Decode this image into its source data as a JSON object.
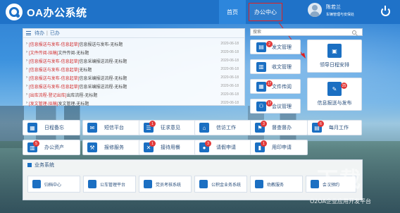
{
  "header": {
    "app_title": "OA办公系统",
    "nav": {
      "home": "首页",
      "office": "办公中心"
    },
    "user": {
      "name": "陈若兰",
      "dept": "车辆管理与安保处"
    }
  },
  "todo": {
    "tabs": [
      "待办",
      "已办"
    ],
    "separator": "|",
    "items": [
      {
        "tag": "[信息报送与发布-信息起草]",
        "text": " 信息报送与发布-无标题",
        "date": "2020-06-18"
      },
      {
        "tag": "[文件传阅-拟稿]",
        "text": " 文件传阅-无标题",
        "date": "2020-06-18"
      },
      {
        "tag": "[信息报送与发布-信息起草]",
        "text": " 信息采编报送流程-无标题",
        "date": "2020-06-18"
      },
      {
        "tag": "[信息报送与发布-信息起草]",
        "text": " 无标题",
        "date": "2020-06-18"
      },
      {
        "tag": "[信息报送与发布-信息起草]",
        "text": " 信息采编报送流程-无标题",
        "date": "2020-06-18"
      },
      {
        "tag": "[信息报送与发布-信息起草]",
        "text": " 信息采编报送流程-无标题",
        "date": "2020-06-18"
      },
      {
        "tag": "[出库流程-登记出库]",
        "text": " 出库流程-无标题",
        "date": "2020-06-18"
      },
      {
        "tag": "[发文管理-拟稿]",
        "text": " 发文管理-无标题",
        "date": "2020-06-18"
      }
    ]
  },
  "search": {
    "placeholder": "搜索"
  },
  "mid_tiles": [
    {
      "label": "发文管理",
      "badge": "2",
      "icon": "document-send-icon"
    },
    {
      "label": "收文管理",
      "badge": "",
      "icon": "document-receive-icon"
    },
    {
      "label": "文件传阅",
      "badge": "17",
      "icon": "file-circulate-icon"
    },
    {
      "label": "会议管理",
      "badge": "17",
      "icon": "meeting-icon"
    }
  ],
  "big_tiles": [
    {
      "label": "领导日程安排",
      "badge": "",
      "icon": "calendar-icon"
    },
    {
      "label": "信息报送与发布",
      "badge": "25",
      "icon": "edit-icon"
    }
  ],
  "row1": [
    {
      "label": "日程备忘",
      "badge": "",
      "icon": "calendar-icon"
    },
    {
      "label": "短信平台",
      "badge": "",
      "icon": "message-icon"
    },
    {
      "label": "征求意见",
      "badge": "1",
      "icon": "opinion-icon"
    },
    {
      "label": "信访工作",
      "badge": "",
      "icon": "house-icon"
    },
    {
      "label": "督查督办",
      "badge": "3",
      "icon": "supervise-icon"
    },
    {
      "label": "每月工作",
      "badge": "6",
      "icon": "monthly-icon"
    }
  ],
  "row2": [
    {
      "label": "办公资产",
      "badge": "5",
      "icon": "assets-icon"
    },
    {
      "label": "报修服务",
      "badge": "",
      "icon": "wrench-icon"
    },
    {
      "label": "接待用餐",
      "badge": "1",
      "icon": "dining-icon"
    },
    {
      "label": "请假申请",
      "badge": "3",
      "icon": "leave-icon"
    },
    {
      "label": "用印申请",
      "badge": "1",
      "icon": "seal-icon"
    }
  ],
  "biz": {
    "title": "业务系统",
    "items": [
      {
        "label": "归档中心",
        "icon": "archive-icon"
      },
      {
        "label": "公车管理平台",
        "icon": "car-icon"
      },
      {
        "label": "党员考核系统",
        "icon": "member-icon"
      },
      {
        "label": "公积金业务系统",
        "icon": "fund-icon"
      },
      {
        "label": "劝教服务",
        "icon": "service-icon"
      },
      {
        "label": "会议预约",
        "icon": "booking-icon"
      }
    ]
  },
  "watermark": {
    "text": "下载",
    "caption": "O2OA企业应用开发平台"
  },
  "colors": {
    "header": "#1f72c8",
    "accent": "#1b6fc2",
    "badge": "#e23a3a",
    "tag": "#d23030",
    "highlight": "#e02020"
  }
}
